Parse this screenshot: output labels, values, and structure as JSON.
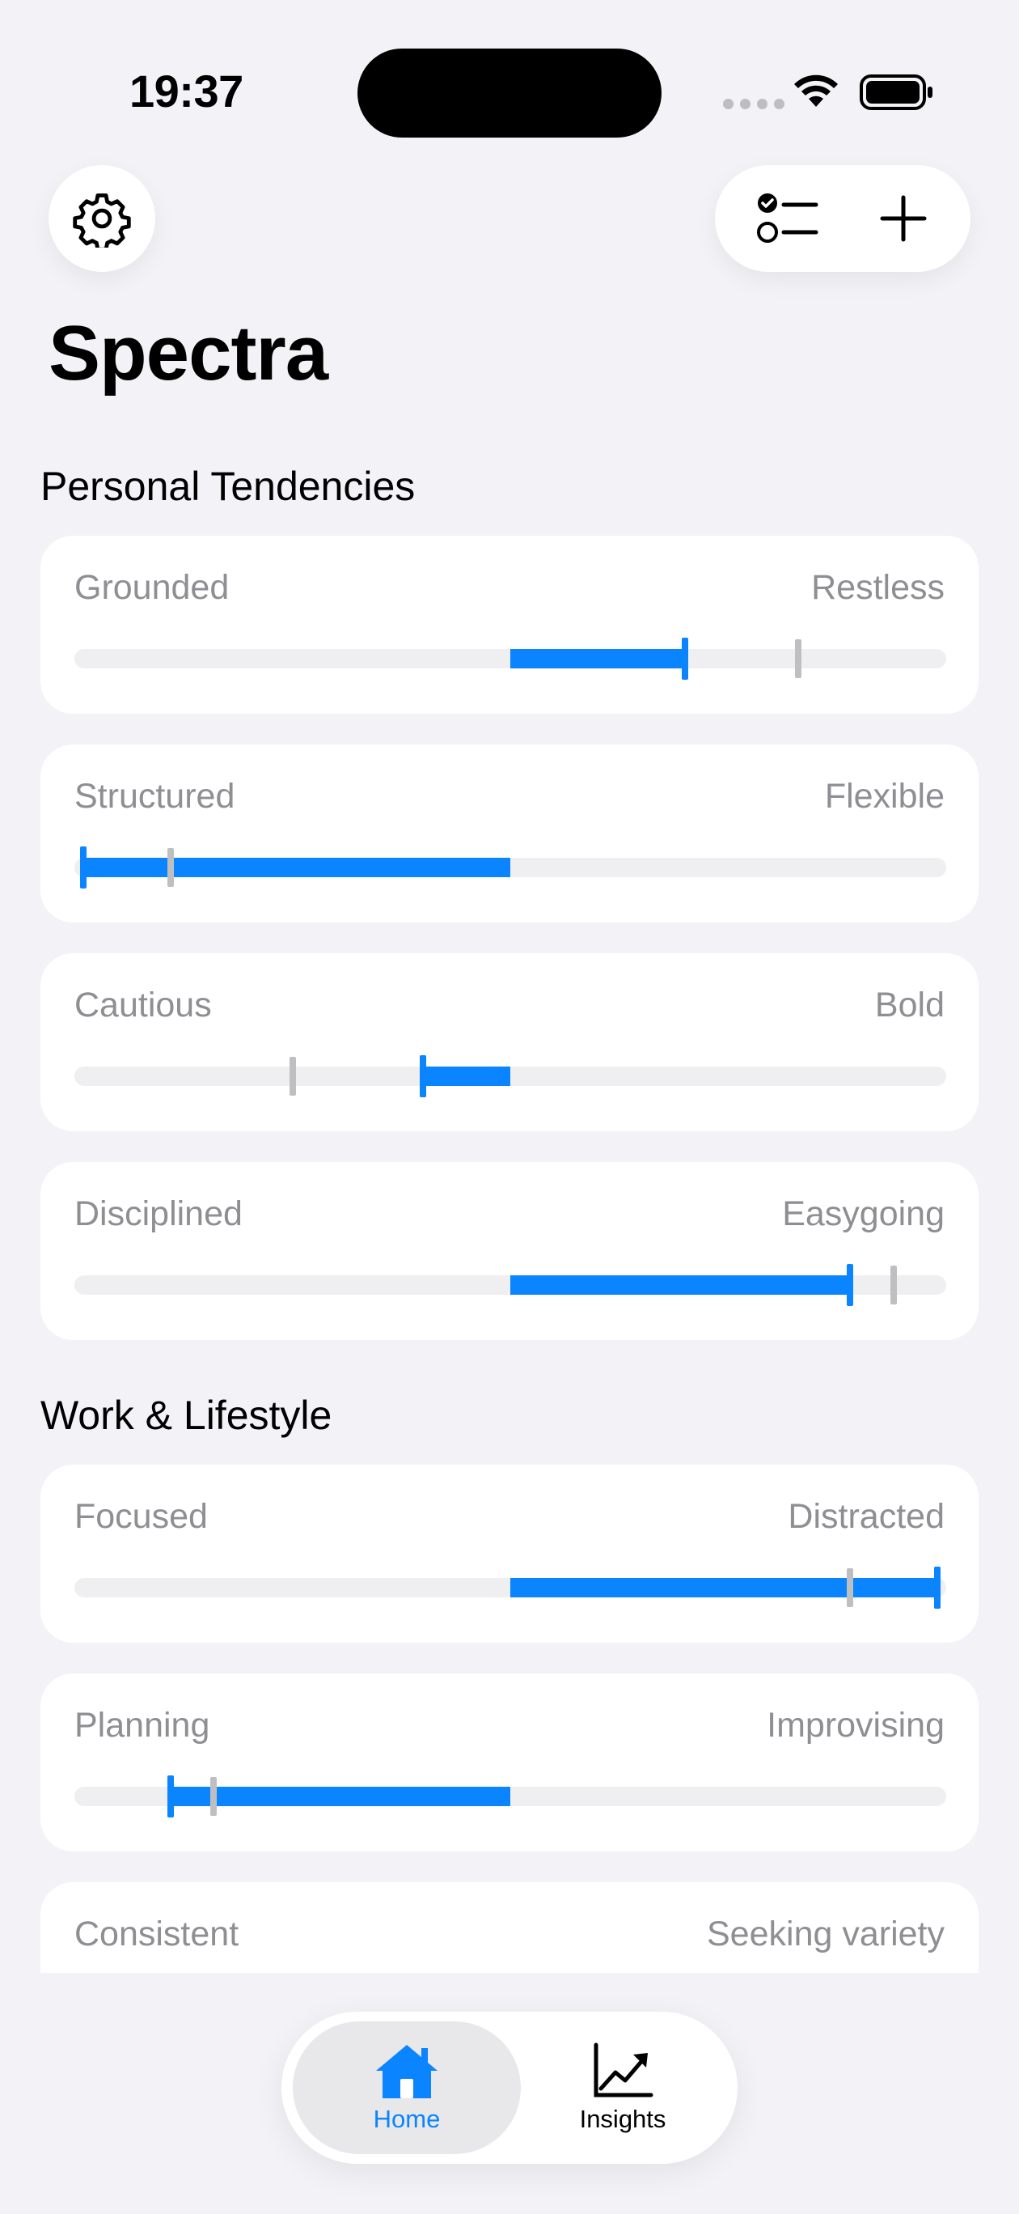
{
  "status_bar": {
    "time": "19:37"
  },
  "header": {
    "title": "Spectra",
    "icons": {
      "settings": "gear-icon",
      "checklist": "checklist-icon",
      "add": "plus-icon"
    }
  },
  "sections": [
    {
      "title": "Personal Tendencies"
    },
    {
      "title": "Work & Lifestyle"
    }
  ],
  "traits": [
    {
      "left": "Grounded",
      "right": "Restless",
      "value": 0.2,
      "reference": 0.33
    },
    {
      "left": "Structured",
      "right": "Flexible",
      "value": -0.49,
      "reference": -0.39
    },
    {
      "left": "Cautious",
      "right": "Bold",
      "value": -0.1,
      "reference": -0.25
    },
    {
      "left": "Disciplined",
      "right": "Easygoing",
      "value": 0.39,
      "reference": 0.44
    },
    {
      "left": "Focused",
      "right": "Distracted",
      "value": 0.49,
      "reference": 0.39
    },
    {
      "left": "Planning",
      "right": "Improvising",
      "value": -0.39,
      "reference": -0.34
    },
    {
      "left": "Consistent",
      "right": "Seeking variety"
    }
  ],
  "tabbar": {
    "tabs": [
      {
        "label": "Home",
        "icon": "home-icon",
        "active": true
      },
      {
        "label": "Insights",
        "icon": "chart-line-icon",
        "active": false
      }
    ]
  },
  "colors": {
    "accent": "#0A84FF",
    "reference": "#BFBFC2",
    "background": "#F2F2F7"
  }
}
